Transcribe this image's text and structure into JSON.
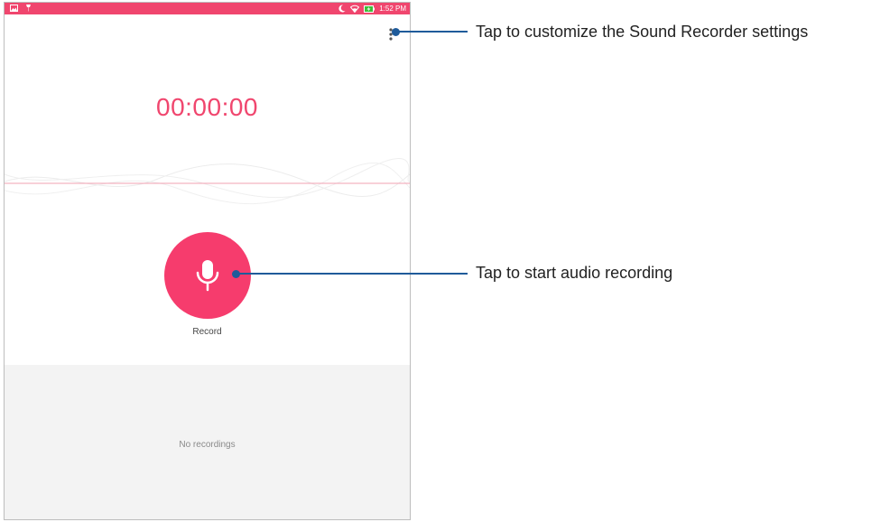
{
  "status_bar": {
    "time": "1:52 PM",
    "left_icons": [
      "image-notification-icon",
      "pin-notification-icon"
    ],
    "right_icons": [
      "moon-icon",
      "wifi-icon",
      "battery-charging-icon"
    ],
    "background_color": "#f0466e"
  },
  "recorder": {
    "timer": "00:00:00",
    "record_label": "Record",
    "empty_list_text": "No recordings",
    "accent_color": "#f63c6d"
  },
  "callouts": {
    "settings": "Tap to customize the Sound Recorder settings",
    "record": "Tap to start audio recording"
  }
}
